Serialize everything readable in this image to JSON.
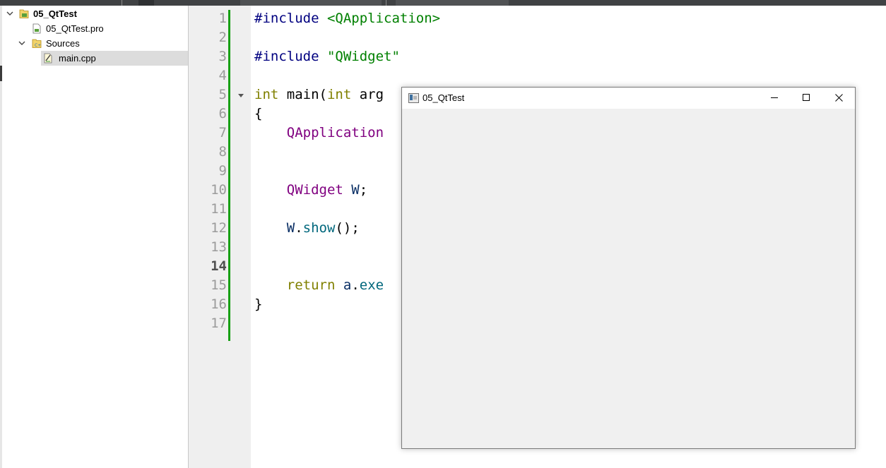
{
  "project_tree": {
    "root": {
      "label": "05_QtTest"
    },
    "items": [
      {
        "label": "05_QtTest.pro"
      },
      {
        "label": "Sources"
      },
      {
        "label": "main.cpp"
      }
    ]
  },
  "editor": {
    "line_numbers": [
      "1",
      "2",
      "3",
      "4",
      "5",
      "6",
      "7",
      "8",
      "9",
      "10",
      "11",
      "12",
      "13",
      "14",
      "15",
      "16",
      "17"
    ],
    "current_line": "14",
    "lines": [
      {
        "tokens": [
          {
            "t": "#include",
            "c": "pp"
          },
          {
            "t": " ",
            "c": ""
          },
          {
            "t": "<QApplication>",
            "c": "str"
          }
        ]
      },
      {
        "tokens": []
      },
      {
        "tokens": [
          {
            "t": "#include",
            "c": "pp"
          },
          {
            "t": " ",
            "c": ""
          },
          {
            "t": "\"QWidget\"",
            "c": "str"
          }
        ]
      },
      {
        "tokens": []
      },
      {
        "tokens": [
          {
            "t": "int",
            "c": "kw"
          },
          {
            "t": " main(",
            "c": ""
          },
          {
            "t": "int",
            "c": "kw"
          },
          {
            "t": " arg",
            "c": ""
          }
        ]
      },
      {
        "tokens": [
          {
            "t": "{",
            "c": ""
          }
        ]
      },
      {
        "tokens": [
          {
            "t": "    ",
            "c": ""
          },
          {
            "t": "QApplication",
            "c": "cls"
          }
        ]
      },
      {
        "tokens": []
      },
      {
        "tokens": []
      },
      {
        "tokens": [
          {
            "t": "    ",
            "c": ""
          },
          {
            "t": "QWidget",
            "c": "cls"
          },
          {
            "t": " ",
            "c": ""
          },
          {
            "t": "W",
            "c": "var"
          },
          {
            "t": ";",
            "c": ""
          }
        ]
      },
      {
        "tokens": []
      },
      {
        "tokens": [
          {
            "t": "    ",
            "c": ""
          },
          {
            "t": "W",
            "c": "var"
          },
          {
            "t": ".",
            "c": ""
          },
          {
            "t": "show",
            "c": "fn"
          },
          {
            "t": "();",
            "c": ""
          }
        ]
      },
      {
        "tokens": []
      },
      {
        "tokens": []
      },
      {
        "tokens": [
          {
            "t": "    ",
            "c": ""
          },
          {
            "t": "return",
            "c": "kw"
          },
          {
            "t": " ",
            "c": ""
          },
          {
            "t": "a",
            "c": "var"
          },
          {
            "t": ".",
            "c": ""
          },
          {
            "t": "exe",
            "c": "fn"
          }
        ]
      },
      {
        "tokens": [
          {
            "t": "}",
            "c": ""
          }
        ]
      },
      {
        "tokens": []
      }
    ]
  },
  "window": {
    "title": "05_QtTest",
    "icon": "app-window-icon",
    "controls": [
      "minimize-icon",
      "maximize-icon",
      "close-icon"
    ]
  },
  "colors": {
    "keyword": "#808000",
    "string": "#008000",
    "class": "#800080",
    "function": "#00677c",
    "variable": "#092e64",
    "preprocessor": "#000080",
    "changed_line_marker": "#17a014"
  }
}
